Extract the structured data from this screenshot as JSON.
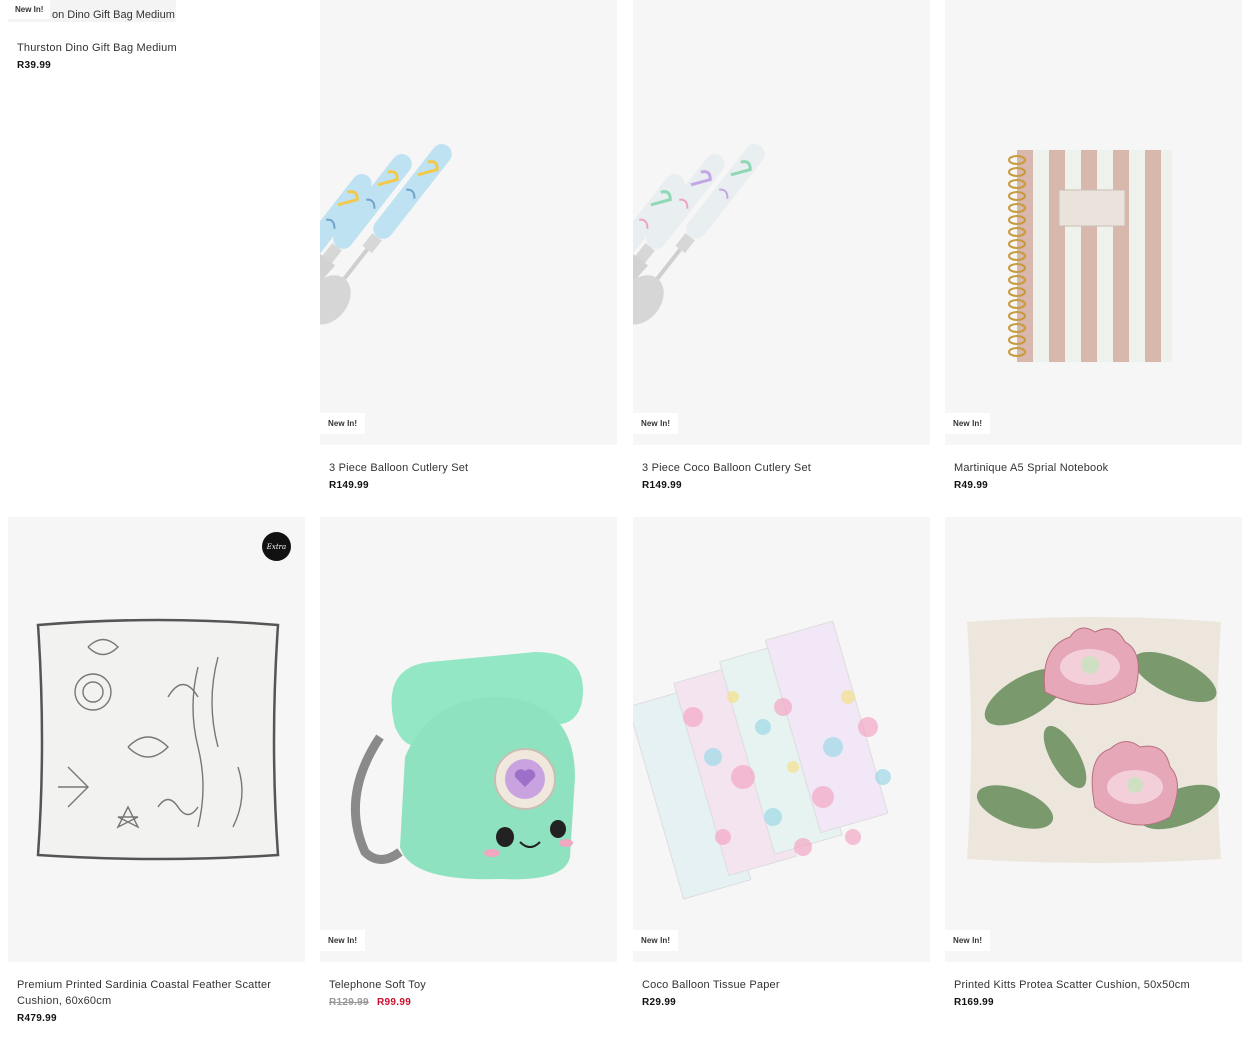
{
  "badges": {
    "new": "New In!",
    "extra": "Extra"
  },
  "colors": {
    "sale": "#c8102e",
    "card_bg": "#f6f6f6"
  },
  "products": [
    {
      "title": "Thurston Dino Gift Bag Medium",
      "image_caption": "on Dino Gift Bag Medium",
      "price": "R39.99",
      "new": true
    },
    {
      "title": "3 Piece Balloon Cutlery Set",
      "price": "R149.99",
      "new": true,
      "image_icon": "cutlery-icon"
    },
    {
      "title": "3 Piece Coco Balloon Cutlery Set",
      "price": "R149.99",
      "new": true,
      "image_icon": "cutlery-icon"
    },
    {
      "title": "Martinique A5 Sprial Notebook",
      "price": "R49.99",
      "new": true,
      "image_icon": "notebook-icon"
    },
    {
      "title": "Premium Printed Sardinia Coastal Feather Scatter Cushion, 60x60cm",
      "price": "R479.99",
      "new": false,
      "extra": true,
      "image_icon": "cushion-icon"
    },
    {
      "title": "Telephone Soft Toy",
      "price_old": "R129.99",
      "price": "R99.99",
      "new": true,
      "image_icon": "telephone-toy-icon"
    },
    {
      "title": "Coco Balloon Tissue Paper",
      "price": "R29.99",
      "new": true,
      "image_icon": "tissue-paper-icon"
    },
    {
      "title": "Printed Kitts Protea Scatter Cushion, 50x50cm",
      "price": "R169.99",
      "new": true,
      "image_icon": "protea-cushion-icon"
    }
  ]
}
